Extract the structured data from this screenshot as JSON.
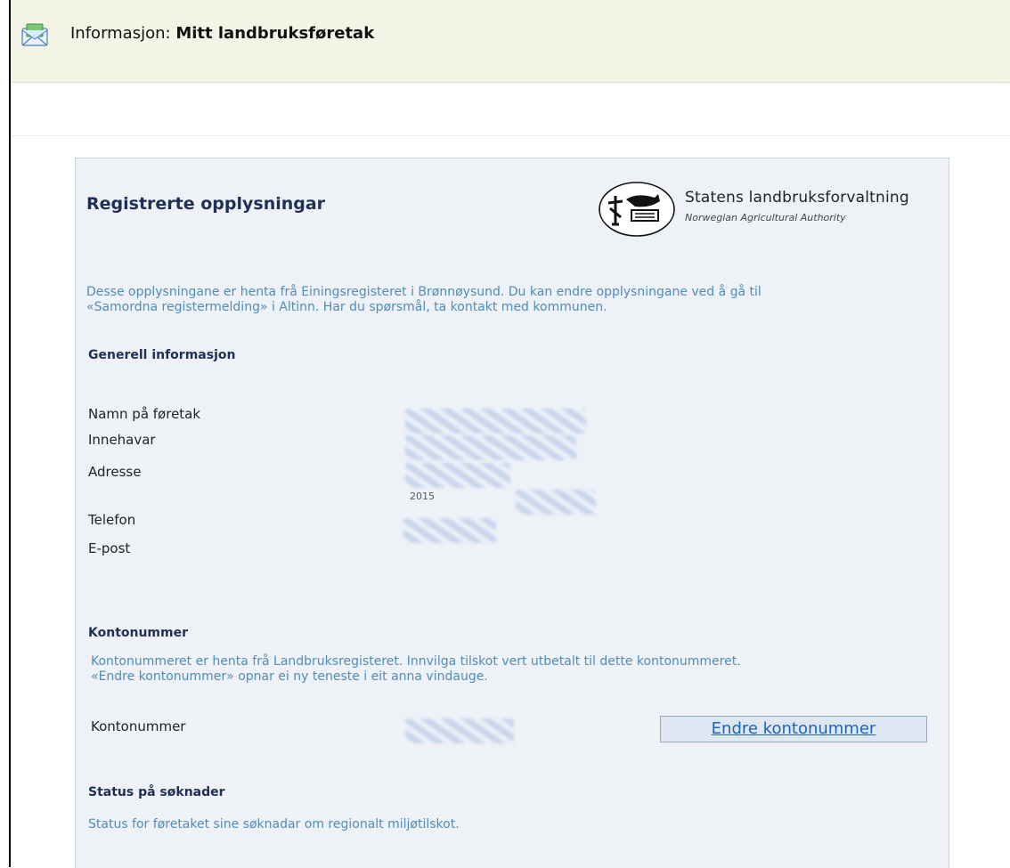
{
  "header": {
    "prefix": "Informasjon:",
    "title": "Mitt landbruksføretak"
  },
  "panel": {
    "title": "Registrerte opplysningar",
    "logo": {
      "name": "Statens landbruksforvaltning",
      "subtitle": "Norwegian Agricultural Authority"
    },
    "intro_line1": "Desse opplysningane er henta frå Einingsregisteret i Brønnøysund. Du kan endre opplysningane ved å gå til",
    "intro_line2": "«Samordna registermelding» i Altinn. Har du spørsmål, ta kontakt med kommunen."
  },
  "general": {
    "heading": "Generell informasjon",
    "labels": {
      "name": "Namn på føretak",
      "owner": "Innehavar",
      "address": "Adresse",
      "phone": "Telefon",
      "email": "E-post"
    },
    "postal_code": "2015"
  },
  "account": {
    "heading": "Kontonummer",
    "desc_line1": "Kontonummeret er henta frå Landbruksregisteret. Innvilga tilskot vert utbetalt til dette kontonummeret.",
    "desc_line2": "«Endre kontonummer» opnar ei ny teneste i eit anna vindauge.",
    "label": "Kontonummer",
    "change_button": "Endre kontonummer"
  },
  "status": {
    "heading": "Status på søknader",
    "desc": "Status for føretaket sine søknadar om regionalt miljøtilskot."
  },
  "colors": {
    "header_bg": "#f3f3e6",
    "panel_bg": "#eef2f7",
    "link_blue": "#1b64b8",
    "info_text": "#4f8cba"
  }
}
